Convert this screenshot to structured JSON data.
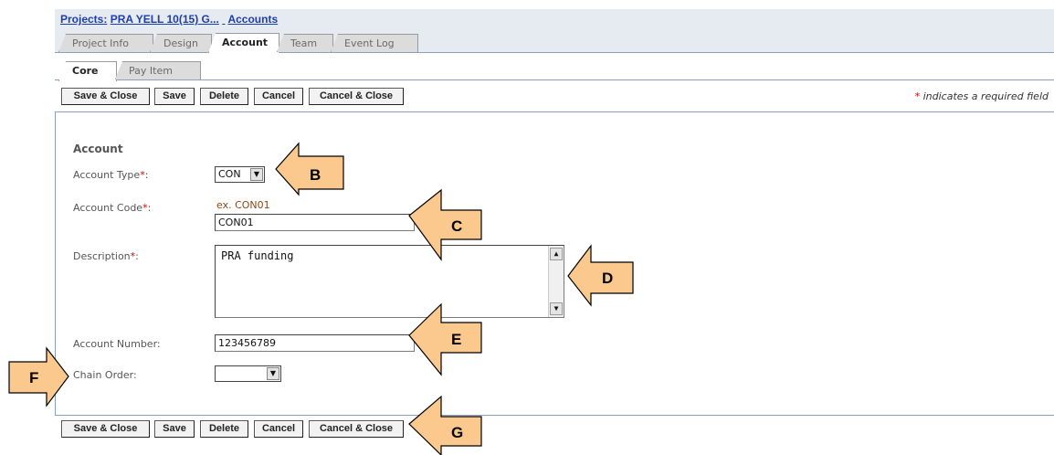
{
  "breadcrumb": {
    "projects_label": "Projects:",
    "project_name": "PRA YELL 10(15) G...",
    "current": "Accounts"
  },
  "tabs": [
    {
      "label": "Project Info",
      "active": false
    },
    {
      "label": "Design",
      "active": false
    },
    {
      "label": "Account",
      "active": true
    },
    {
      "label": "Team",
      "active": false
    },
    {
      "label": "Event Log",
      "active": false
    }
  ],
  "subtabs": [
    {
      "label": "Core",
      "active": true
    },
    {
      "label": "Pay Item",
      "active": false
    }
  ],
  "toolbar": {
    "save_close": "Save & Close",
    "save": "Save",
    "delete": "Delete",
    "cancel": "Cancel",
    "cancel_close": "Cancel & Close"
  },
  "required_note": {
    "star": "*",
    "text": " indicates a required field"
  },
  "form": {
    "section_title": "Account",
    "account_type": {
      "label": "Account Type",
      "value": "CON"
    },
    "account_code": {
      "label": "Account Code",
      "example": "ex. CON01",
      "value": "CON01"
    },
    "description": {
      "label": "Description",
      "value": "PRA funding"
    },
    "account_number": {
      "label": "Account Number:",
      "value": "123456789"
    },
    "chain_order": {
      "label": "Chain Order:",
      "value": ""
    },
    "required_star": "*",
    "colon": ":"
  },
  "callouts": {
    "b": "B",
    "c": "C",
    "d": "D",
    "e": "E",
    "f": "F",
    "g": "G"
  },
  "colors": {
    "callout_fill": "#fbc98e",
    "link": "#1f3fa8",
    "required": "#d40000",
    "border_blue": "#8aa0bf"
  },
  "icons": {
    "dropdown": "chevron-down-icon",
    "scroll_up": "scroll-up-icon",
    "scroll_down": "scroll-down-icon"
  }
}
